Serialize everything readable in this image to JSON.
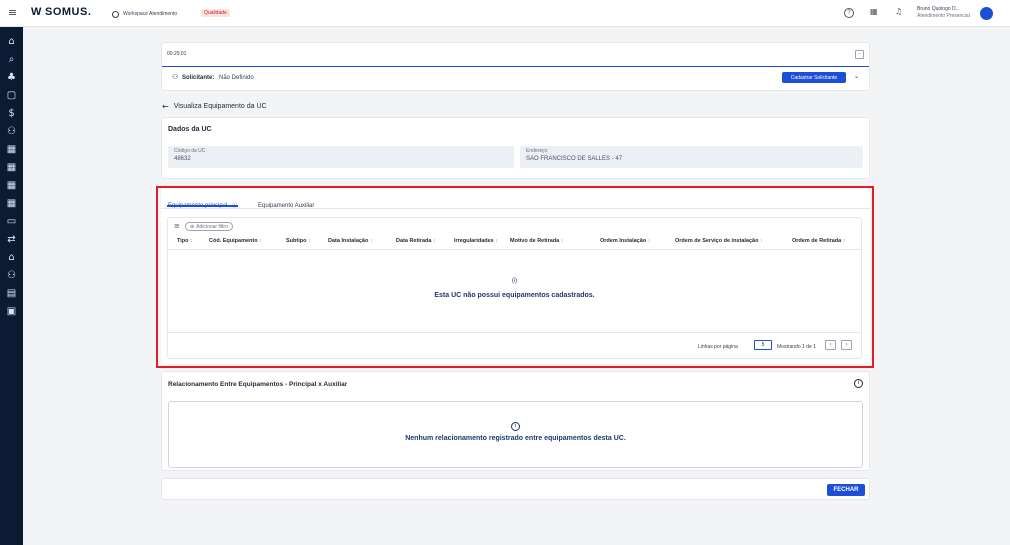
{
  "app": {
    "brand": "SOMUS.",
    "workspace_label": "Workspace Atendimento",
    "badge": "Qualidade",
    "user_name": "Bruno Quologo D...",
    "user_role": "Atendimento Presencial"
  },
  "timer": {
    "value": "00:29:01"
  },
  "solicitante": {
    "label": "Solicitante:",
    "value": "Não Definido",
    "button": "Cadastrar Solicitante"
  },
  "page": {
    "back_title": "Visualiza Equipamento da UC"
  },
  "dados_uc": {
    "title": "Dados da UC",
    "codigo_label": "Código da UC",
    "codigo_value": "48632",
    "endereco_label": "Endereço",
    "endereco_value": "SAO FRANCISCO DE SALLES - 47"
  },
  "tabs": [
    {
      "label": "Equipamento principal",
      "active": true
    },
    {
      "label": "Equipamento Auxiliar",
      "active": false
    }
  ],
  "table": {
    "filter_button": "Adicionar filtro",
    "columns": [
      "Tipo",
      "Cód. Equipamento",
      "Subtipo",
      "Data Instalação",
      "Data Retirada",
      "Irregularidades",
      "Motivo de Retirada",
      "Ordem Instalação",
      "Ordem de Serviço de instalação",
      "Ordem de Retirada"
    ],
    "empty_icon": "(i)",
    "empty_message": "Esta UC não possui equipamentos cadastrados.",
    "rows_per_page_label": "Linhas por página",
    "rows_per_page_value": "5",
    "showing_label": "Mostrando 1 de 1"
  },
  "relacionamento": {
    "title": "Relacionamento Entre Equipamentos - Principal x Auxiliar",
    "empty_message": "Nenhum relacionamento registrado entre equipamentos desta UC."
  },
  "footer": {
    "close_button": "FECHAR"
  },
  "colors": {
    "accent": "#1d4ed8",
    "highlight": "#e11d2a",
    "sidebar": "#0c1a33"
  }
}
